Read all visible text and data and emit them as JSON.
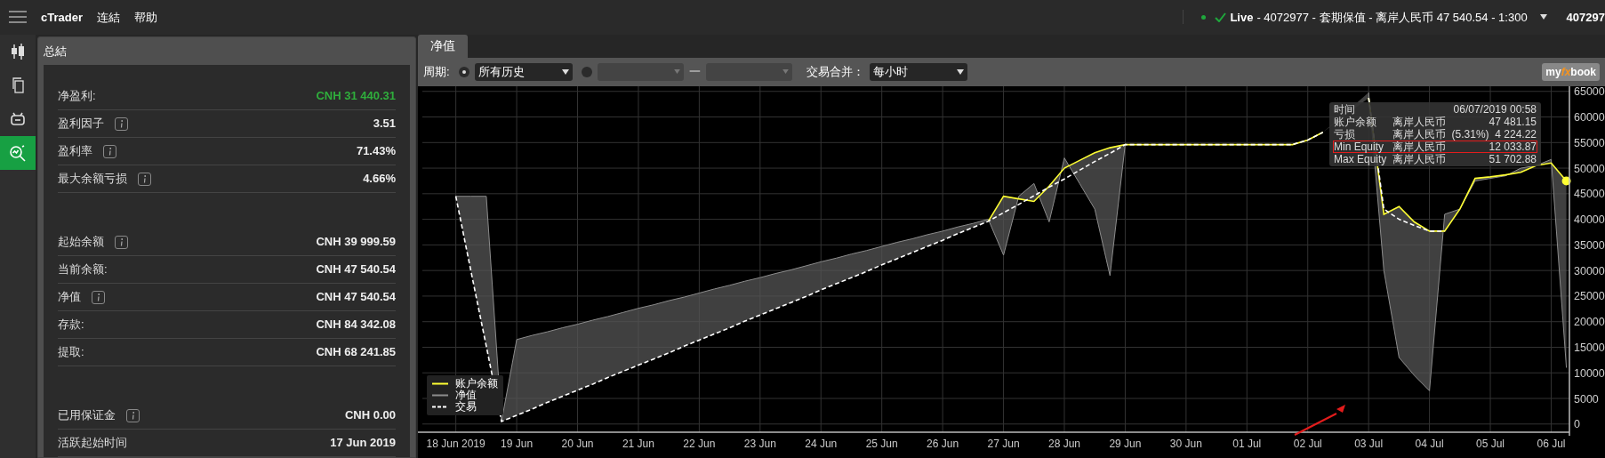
{
  "topbar": {
    "brand": "cTrader",
    "menu": [
      "连結",
      "帮助"
    ],
    "account": {
      "connected": true,
      "mode": "Live",
      "details": " - 4072977 - 套期保值 - 离岸人民币 47 540.54 - 1:300",
      "id": "407297"
    }
  },
  "rail": [
    {
      "selected": false
    },
    {
      "selected": false
    },
    {
      "selected": false
    },
    {
      "selected": true
    }
  ],
  "summary": {
    "title": "总結",
    "groups": [
      [
        {
          "label": "净盈利:",
          "info": false,
          "value": "CNH 31 440.31",
          "positive": true
        },
        {
          "label": "盈利因子",
          "info": true,
          "value": "3.51",
          "positive": false
        },
        {
          "label": "盈利率",
          "info": true,
          "value": "71.43%",
          "positive": false
        },
        {
          "label": "最大余额亏损",
          "info": true,
          "value": "4.66%",
          "positive": false
        }
      ],
      [
        {
          "label": "起始余额",
          "info": true,
          "value": "CNH 39 999.59",
          "positive": false
        },
        {
          "label": "当前余额:",
          "info": false,
          "value": "CNH 47 540.54",
          "positive": false
        },
        {
          "label": "净值",
          "info": true,
          "value": "CNH 47 540.54",
          "positive": false
        },
        {
          "label": "存款:",
          "info": false,
          "value": "CNH 84 342.08",
          "positive": false
        },
        {
          "label": "提取:",
          "info": false,
          "value": "CNH 68 241.85",
          "positive": false
        }
      ],
      [
        {
          "label": "已用保证金",
          "info": true,
          "value": "CNH 0.00",
          "positive": false
        },
        {
          "label": "活跃起始时间",
          "info": false,
          "value": "17 Jun 2019",
          "positive": false
        }
      ]
    ]
  },
  "tabs": [
    {
      "label": "净值",
      "selected": true
    }
  ],
  "toolbar": {
    "period_label": "周期:",
    "period_options": [
      {
        "kind": "preset",
        "selected": true,
        "value": "所有历史"
      },
      {
        "kind": "range",
        "selected": false,
        "separator": "一"
      }
    ],
    "merge_label": "交易合并：",
    "merge_value": "每小时",
    "logo": [
      "my",
      "fx",
      "book"
    ]
  },
  "chart": {
    "chart_data": {
      "type": "line",
      "categories": [
        "18 Jun 2019",
        null,
        null,
        null,
        "19 Jun",
        null,
        null,
        null,
        "20 Jun",
        null,
        null,
        null,
        "21 Jun",
        null,
        null,
        null,
        "22 Jun",
        null,
        null,
        null,
        "23 Jun",
        null,
        null,
        null,
        "24 Jun",
        null,
        null,
        null,
        "25 Jun",
        null,
        null,
        null,
        "26 Jun",
        null,
        null,
        null,
        "27 Jun",
        null,
        null,
        null,
        "28 Jun",
        null,
        null,
        null,
        "29 Jun",
        null,
        null,
        null,
        "30 Jun",
        null,
        null,
        null,
        "01 Jul",
        null,
        null,
        null,
        "02 Jul",
        null,
        null,
        null,
        "03 Jul",
        null,
        null,
        null,
        "04 Jul",
        null,
        null,
        null,
        "05 Jul",
        null,
        null,
        null,
        "06 Jul",
        null
      ],
      "series": [
        {
          "name": "账户余额",
          "color": "#ffff33",
          "values": [
            null,
            null,
            null,
            null,
            null,
            null,
            null,
            null,
            null,
            null,
            null,
            null,
            null,
            null,
            null,
            null,
            null,
            null,
            null,
            null,
            null,
            null,
            null,
            null,
            null,
            null,
            null,
            null,
            null,
            null,
            null,
            null,
            null,
            null,
            null,
            39600,
            44500,
            44000,
            43500,
            46500,
            50000,
            51500,
            53000,
            54000,
            54600,
            54600,
            54600,
            54600,
            54600,
            54600,
            54600,
            54600,
            54600,
            54600,
            54600,
            54600,
            55500,
            57000,
            null,
            null,
            63700,
            41000,
            42500,
            39500,
            37700,
            37700,
            42000,
            48000,
            48300,
            48700,
            49200,
            50500,
            51000,
            47500
          ]
        },
        {
          "name": "净值",
          "color": "#8c8c8c",
          "values": [
            44500,
            44500,
            44500,
            500,
            16500,
            17300,
            18000,
            18800,
            19500,
            20300,
            21000,
            21800,
            22600,
            23300,
            24100,
            24800,
            25600,
            26400,
            27100,
            27900,
            28600,
            29400,
            30100,
            30900,
            31700,
            32400,
            33200,
            33900,
            34700,
            35500,
            36200,
            37000,
            37700,
            38500,
            39200,
            40000,
            33000,
            44500,
            47000,
            39500,
            52000,
            47000,
            42000,
            29000,
            54600,
            54600,
            54600,
            54600,
            54600,
            54600,
            54600,
            54600,
            54600,
            54600,
            54600,
            54600,
            55500,
            57000,
            null,
            null,
            64800,
            30000,
            13000,
            9500,
            6500,
            41000,
            42000,
            47500,
            48000,
            48500,
            50000,
            50500,
            51700,
            11000
          ]
        },
        {
          "name": "交易",
          "color": "#ffffff",
          "line_style": "dashed",
          "values": [
            44500,
            29800,
            15200,
            500,
            1700,
            2900,
            4200,
            5400,
            6600,
            7800,
            9100,
            10300,
            11500,
            12700,
            13900,
            15200,
            16400,
            17600,
            18800,
            20100,
            21300,
            22500,
            23700,
            24900,
            26200,
            27400,
            28600,
            29800,
            31100,
            32300,
            33500,
            34700,
            35900,
            37200,
            38400,
            39600,
            41300,
            42900,
            44600,
            46300,
            47900,
            49600,
            51300,
            52900,
            54600,
            54600,
            54600,
            54600,
            54600,
            54600,
            54600,
            54600,
            54600,
            54600,
            54600,
            54600,
            55500,
            57000,
            null,
            null,
            63700,
            42000,
            40000,
            38800,
            37700,
            37700,
            null,
            null,
            null,
            null,
            null,
            null,
            null,
            null
          ]
        }
      ],
      "grid": true,
      "ylim": [
        -1600,
        66000
      ],
      "yticks": [
        0,
        5000,
        10000,
        15000,
        20000,
        25000,
        30000,
        35000,
        40000,
        45000,
        50000,
        55000,
        60000,
        65000
      ]
    },
    "tooltip": {
      "rows": [
        {
          "label": "时间",
          "value": "06/07/2019 00:58",
          "highlighted": false
        },
        {
          "label": "账户余额",
          "currency": "离岸人民币",
          "value": "47 481.15",
          "highlighted": false
        },
        {
          "label": "亏损",
          "currency": "离岸人民币",
          "value": "(5.31%)  4 224.22",
          "highlighted": false
        },
        {
          "label": "Min Equity",
          "currency": "离岸人民币",
          "value": "12 033.87",
          "highlighted": true
        },
        {
          "label": "Max Equity",
          "currency": "离岸人民币",
          "value": "51 702.88",
          "highlighted": false
        }
      ]
    }
  }
}
